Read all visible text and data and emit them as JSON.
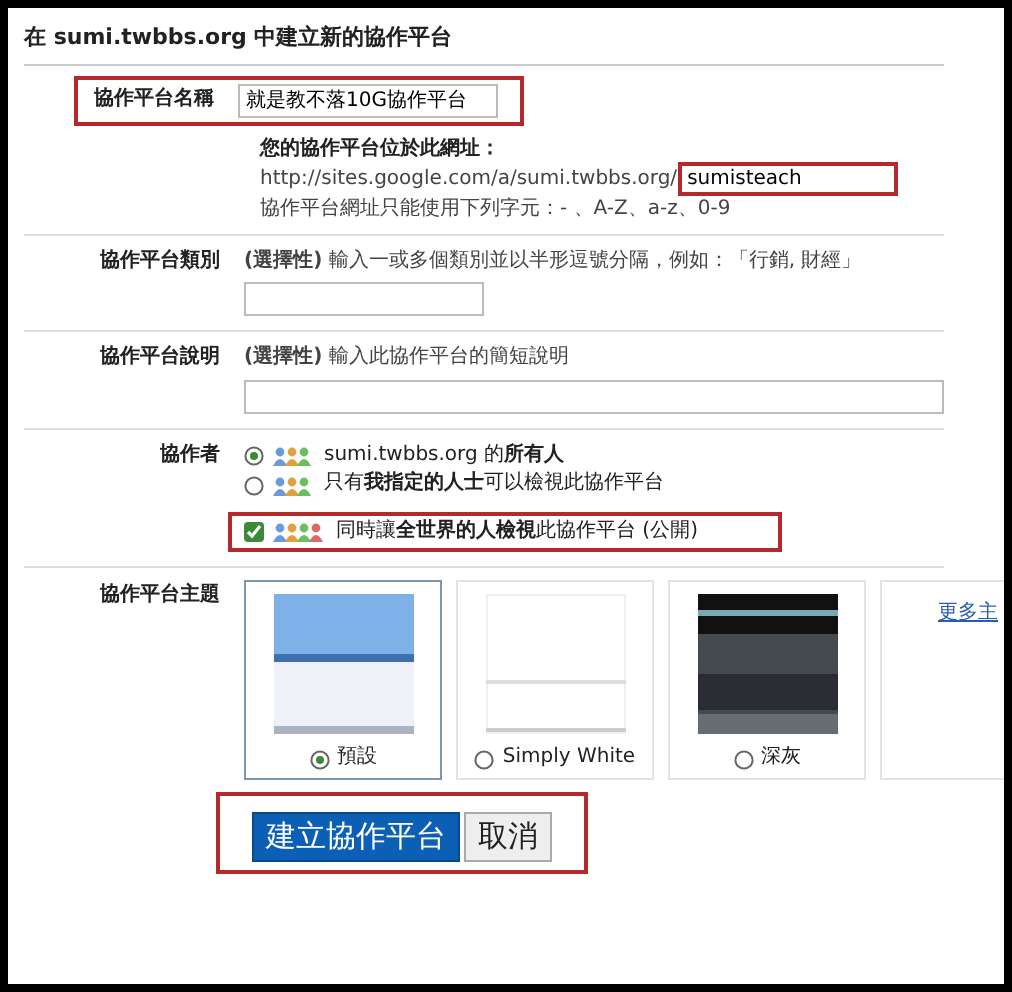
{
  "title": "在 sumi.twbbs.org 中建立新的協作平台",
  "name_row": {
    "label": "協作平台名稱",
    "value": "就是教不落10G協作平台",
    "highlighted": true
  },
  "url": {
    "heading": "您的協作平台位於此網址：",
    "prefix": "http://sites.google.com/a/sumi.twbbs.org/",
    "value": "sumisteach",
    "highlighted": true,
    "hint": "協作平台網址只能使用下列字元：- 、A-Z、a-z、0-9"
  },
  "category": {
    "label": "協作平台類別",
    "help": "**(選擇性)** 輸入一或多個類別並以半形逗號分隔，例如：「行銷, 財經」"
  },
  "description": {
    "label": "協作平台說明",
    "help": "**(選擇性)** 輸入此協作平台的簡短說明"
  },
  "collaborators": {
    "label": "協作者",
    "options": [
      {
        "text": "sumi.twbbs.org 的**所有人**",
        "selected": true
      },
      {
        "text": "只有**我指定的人士**可以檢視此協作平台",
        "selected": false
      }
    ],
    "public": {
      "text": "同時讓**全世界的人檢視**此協作平台 (公開)",
      "checked": true,
      "highlighted": true
    }
  },
  "themes": {
    "label": "協作平台主題",
    "items": [
      {
        "kind": "default",
        "name": "預設",
        "selected": true
      },
      {
        "kind": "simple",
        "name": "Simply White",
        "selected": false
      },
      {
        "kind": "dark",
        "name": "深灰",
        "selected": false
      }
    ],
    "more_link": "更多主"
  },
  "buttons": {
    "highlighted": true,
    "items": [
      {
        "kind": "primary",
        "label": "建立協作平台"
      },
      {
        "kind": "secondary",
        "label": "取消"
      }
    ]
  }
}
